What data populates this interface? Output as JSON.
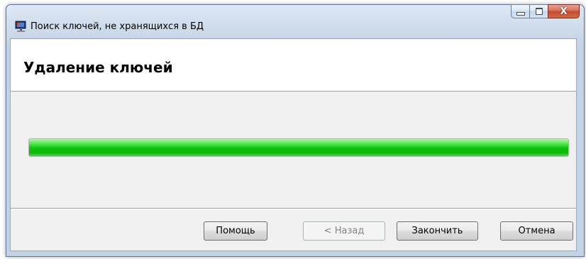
{
  "window": {
    "title": "Поиск ключей, не хранящихся в БД",
    "app_icon": "computer-icon",
    "controls": {
      "minimize": "minimize-icon",
      "maximize": "maximize-icon",
      "close": "close-icon",
      "close_glyph": "X"
    }
  },
  "wizard": {
    "page_title": "Удаление ключей",
    "progress": {
      "value": 1.0,
      "color": "#12c410"
    }
  },
  "buttons": {
    "help": "Помощь",
    "back": "< Назад",
    "finish": "Закончить",
    "cancel": "Отмена"
  },
  "colors": {
    "accent_close": "#c44a2e",
    "progress_green": "#07c406"
  }
}
